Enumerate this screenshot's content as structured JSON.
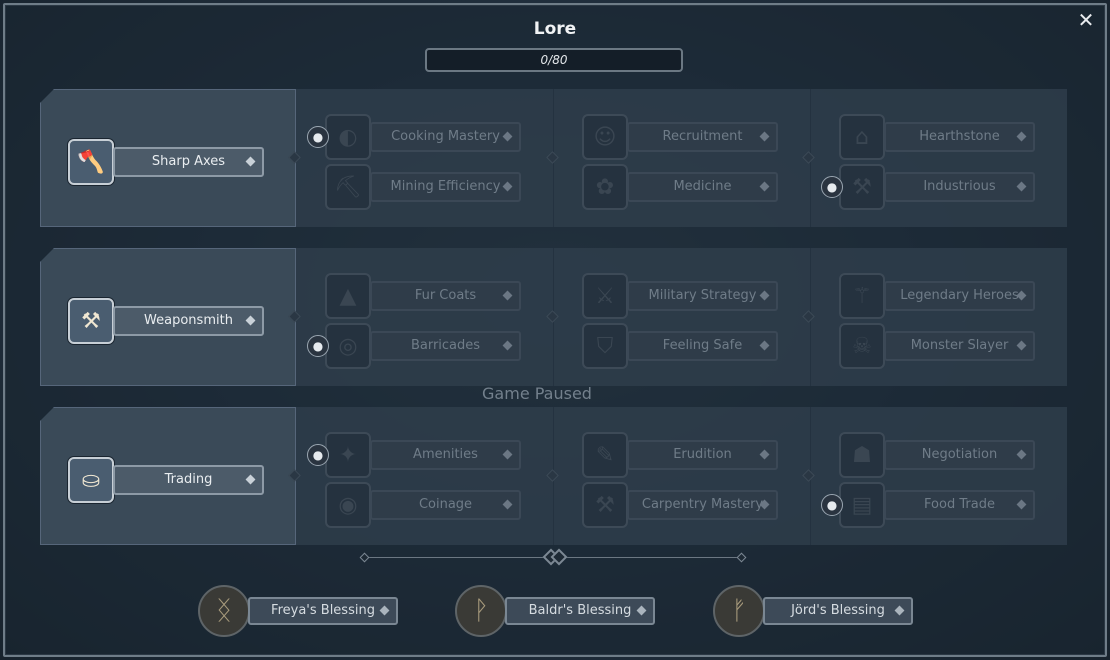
{
  "title": "Lore",
  "progress": {
    "text": "0/80",
    "value": 0,
    "max": 80
  },
  "close_symbol": "✕",
  "status": "Game Paused",
  "rows": [
    {
      "root": {
        "label": "Sharp Axes",
        "icon": "sharp-axes-icon",
        "glyph": "🪓"
      },
      "columns": [
        [
          {
            "label": "Cooking Mastery",
            "icon": "cooking-pot-icon",
            "glyph": "◐",
            "locked": true
          },
          {
            "label": "Mining Efficiency",
            "icon": "pickaxe-icon",
            "glyph": "⛏",
            "locked": false
          }
        ],
        [
          {
            "label": "Recruitment",
            "icon": "recruit-face-icon",
            "glyph": "☺",
            "locked": false
          },
          {
            "label": "Medicine",
            "icon": "herb-leaf-icon",
            "glyph": "✿",
            "locked": false
          }
        ],
        [
          {
            "label": "Hearthstone",
            "icon": "hearthstone-icon",
            "glyph": "⌂",
            "locked": false
          },
          {
            "label": "Industrious",
            "icon": "industrious-icon",
            "glyph": "⚒",
            "locked": true
          }
        ]
      ]
    },
    {
      "root": {
        "label": "Weaponsmith",
        "icon": "anvil-icon",
        "glyph": "⚒"
      },
      "columns": [
        [
          {
            "label": "Fur Coats",
            "icon": "fur-coat-icon",
            "glyph": "▲",
            "locked": false
          },
          {
            "label": "Barricades",
            "icon": "barricade-icon",
            "glyph": "◎",
            "locked": true
          }
        ],
        [
          {
            "label": "Military Strategy",
            "icon": "crossed-swords-icon",
            "glyph": "⚔",
            "locked": false
          },
          {
            "label": "Feeling Safe",
            "icon": "shield-icon",
            "glyph": "⛉",
            "locked": false
          }
        ],
        [
          {
            "label": "Legendary Heroes",
            "icon": "battle-axe-icon",
            "glyph": "⚚",
            "locked": false
          },
          {
            "label": "Monster Slayer",
            "icon": "monster-icon",
            "glyph": "☠",
            "locked": false
          }
        ]
      ]
    },
    {
      "root": {
        "label": "Trading",
        "icon": "coins-icon",
        "glyph": "⛀"
      },
      "columns": [
        [
          {
            "label": "Amenities",
            "icon": "amenities-icon",
            "glyph": "✦",
            "locked": true
          },
          {
            "label": "Coinage",
            "icon": "coin-icon",
            "glyph": "◉",
            "locked": false
          }
        ],
        [
          {
            "label": "Erudition",
            "icon": "scroll-icon",
            "glyph": "✎",
            "locked": false
          },
          {
            "label": "Carpentry Mastery",
            "icon": "hammer-icon",
            "glyph": "⚒",
            "locked": false
          }
        ],
        [
          {
            "label": "Negotiation",
            "icon": "handshake-icon",
            "glyph": "☗",
            "locked": false
          },
          {
            "label": "Food Trade",
            "icon": "food-cart-icon",
            "glyph": "▤",
            "locked": true
          }
        ]
      ]
    }
  ],
  "blessings": [
    {
      "label": "Freya's Blessing",
      "icon": "freya-rune-icon",
      "glyph": "ᛝ"
    },
    {
      "label": "Baldr's Blessing",
      "icon": "baldr-rune-icon",
      "glyph": "ᚹ"
    },
    {
      "label": "Jörd's Blessing",
      "icon": "jord-rune-icon",
      "glyph": "ᚠ"
    }
  ]
}
